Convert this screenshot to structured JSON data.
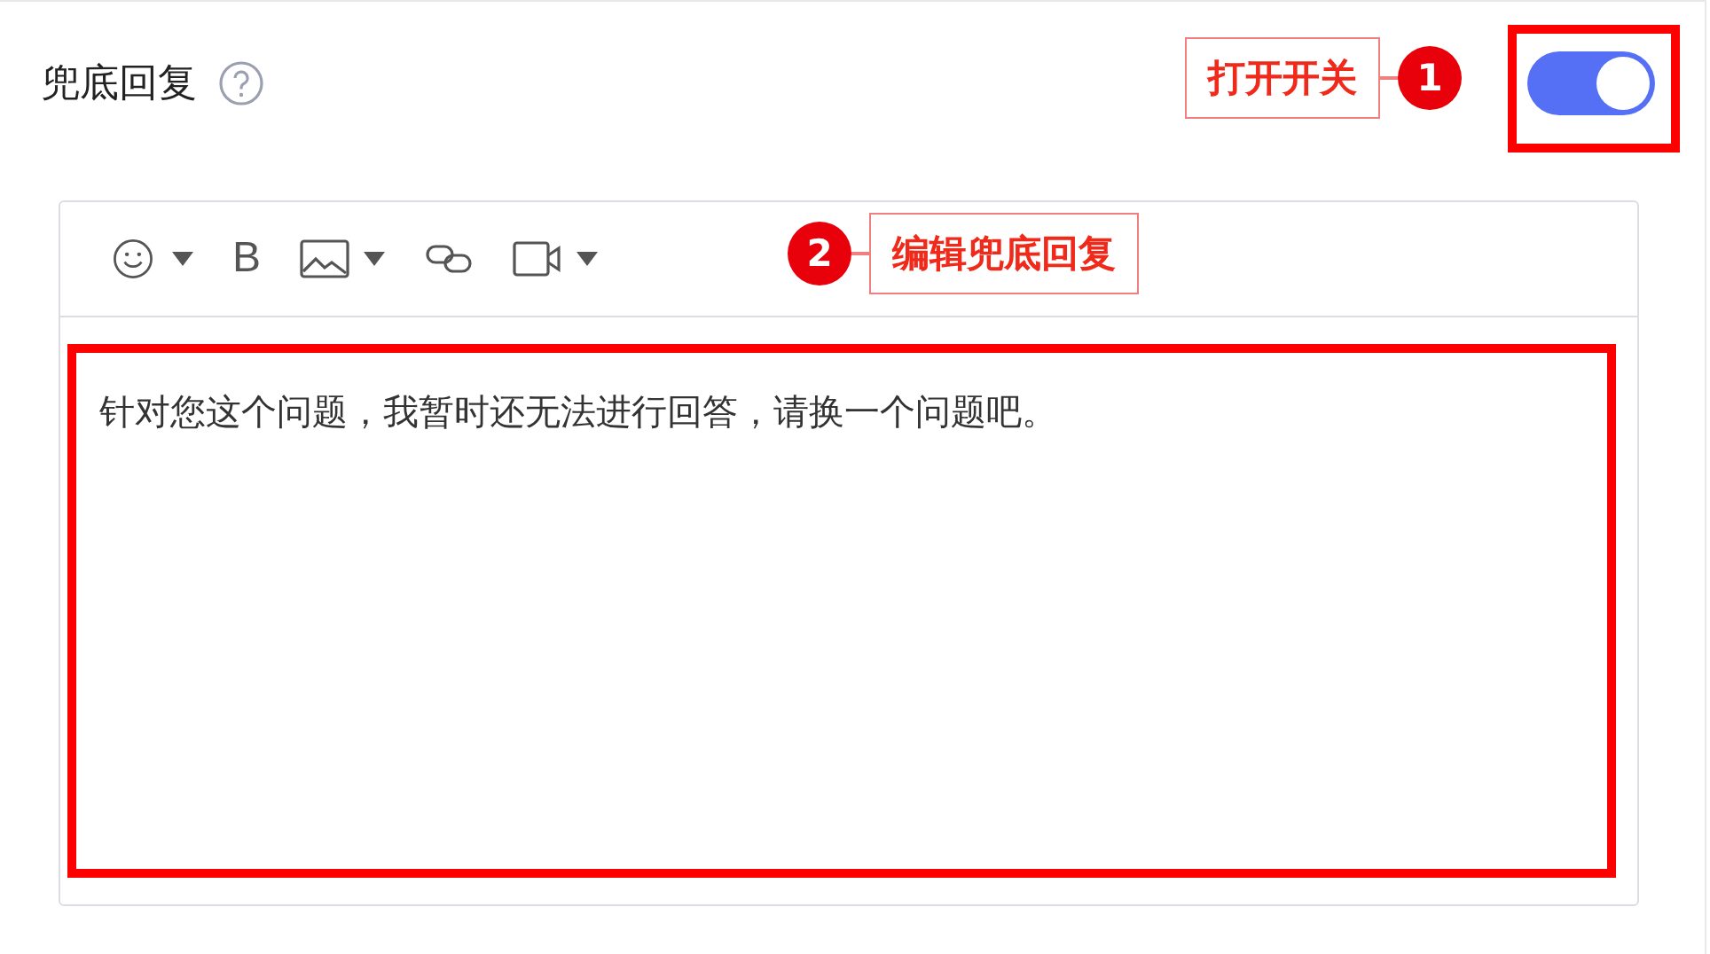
{
  "setting": {
    "title": "兜底回复",
    "enabled": true
  },
  "editor": {
    "tools": [
      {
        "kind": "emoji",
        "dropdown": true
      },
      {
        "kind": "bold",
        "label": "B",
        "dropdown": false
      },
      {
        "kind": "image",
        "dropdown": true
      },
      {
        "kind": "link",
        "dropdown": false
      },
      {
        "kind": "video",
        "dropdown": true
      }
    ],
    "content": "针对您这个问题，我暂时还无法进行回答，请换一个问题吧。"
  },
  "annotations": [
    {
      "number": "1",
      "label": "打开开关"
    },
    {
      "number": "2",
      "label": "编辑兜底回复"
    }
  ]
}
